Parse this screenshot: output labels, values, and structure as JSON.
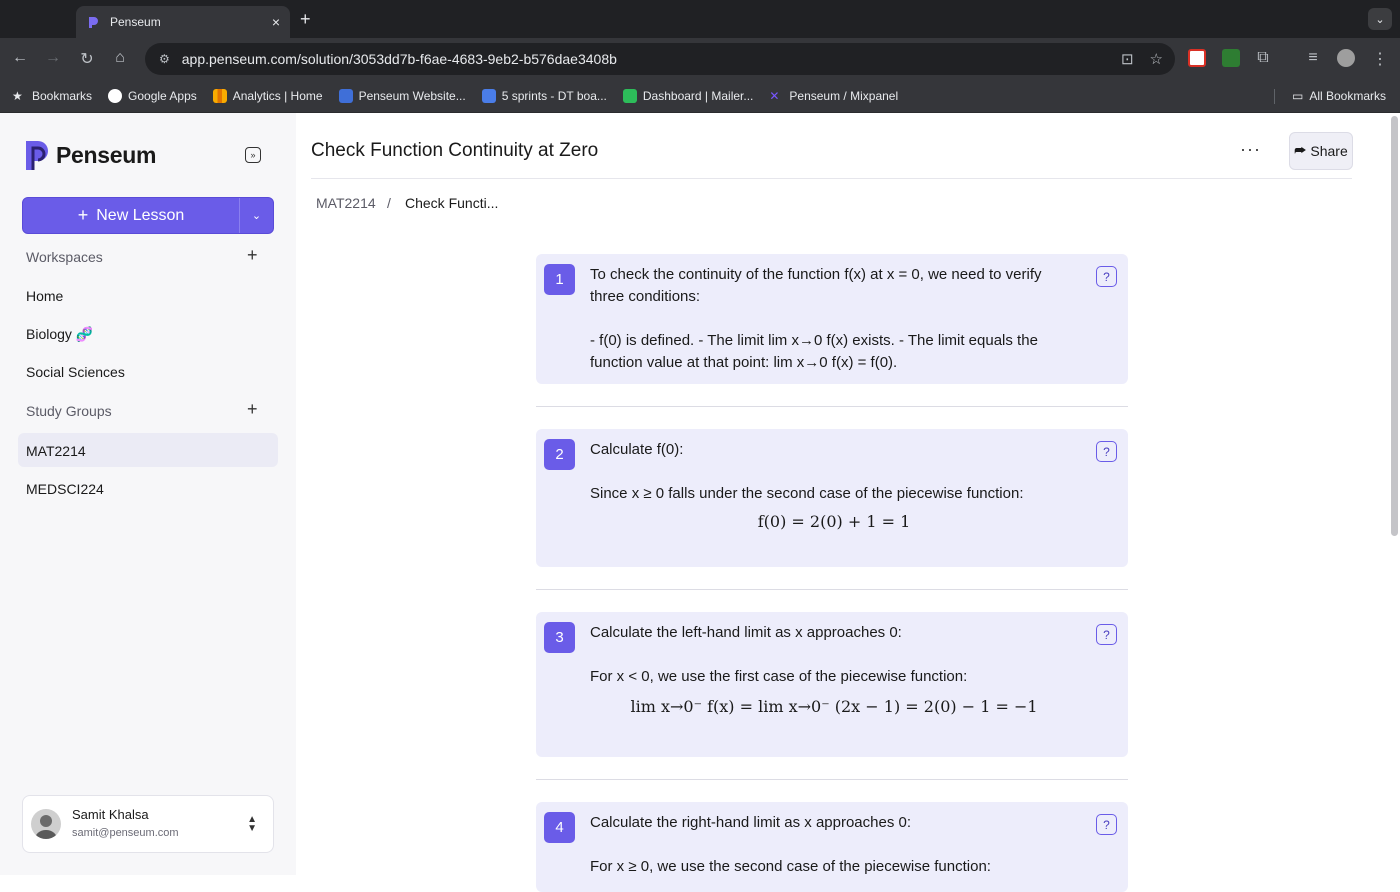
{
  "browser": {
    "tab_title": "Penseum",
    "tab_close": "×",
    "new_tab": "+",
    "url": "app.penseum.com/solution/3053dd7b-f6ae-4683-9eb2-b576dae3408b",
    "bookmarks": [
      {
        "label": "Bookmarks",
        "icon": "star-icon"
      },
      {
        "label": "Google Apps",
        "icon": "google-icon"
      },
      {
        "label": "Analytics | Home",
        "icon": "analytics-icon"
      },
      {
        "label": "Penseum Website...",
        "icon": "penseum-site-icon"
      },
      {
        "label": "5 sprints - DT boa...",
        "icon": "sprints-icon"
      },
      {
        "label": "Dashboard | Mailer...",
        "icon": "mailer-icon"
      },
      {
        "label": "Penseum / Mixpanel",
        "icon": "mixpanel-icon"
      }
    ],
    "all_bookmarks": "All Bookmarks"
  },
  "sidebar": {
    "logo_text": "Penseum",
    "new_lesson": "New Lesson",
    "workspaces_label": "Workspaces",
    "workspace_items": [
      "Home",
      "Biology 🧬",
      "Social Sciences"
    ],
    "study_groups_label": "Study Groups",
    "study_group_items": [
      "MAT2214",
      "MEDSCI224"
    ],
    "active_item": "MAT2214",
    "user": {
      "name": "Samit Khalsa",
      "email": "samit@penseum.com"
    }
  },
  "main": {
    "title": "Check Function Continuity at Zero",
    "more": "···",
    "share": "Share",
    "breadcrumb": [
      "MAT2214",
      "Check Functi..."
    ],
    "breadcrumb_sep": "/",
    "steps": [
      {
        "number": "1",
        "lines": [
          "To check the continuity of the function f(x) at x = 0, we need to verify three conditions:",
          "- f(0) is defined. - The limit lim x→0 f(x) exists. - The limit equals the function value at that point: lim x→0 f(x) = f(0)."
        ]
      },
      {
        "number": "2",
        "lines": [
          "Calculate f(0):",
          "Since x ≥ 0 falls under the second case of the piecewise function:"
        ],
        "display": "f(0) = 2(0) + 1 = 1"
      },
      {
        "number": "3",
        "lines": [
          "Calculate the left-hand limit as x approaches 0:",
          "For x < 0, we use the first case of the piecewise function:"
        ],
        "display": "lim x→0⁻ f(x) = lim x→0⁻ (2x − 1) = 2(0) − 1 = −1"
      },
      {
        "number": "4",
        "lines": [
          "Calculate the right-hand limit as x approaches 0:",
          "For x ≥ 0, we use the second case of the piecewise function:"
        ]
      }
    ],
    "help_glyph": "?"
  },
  "colors": {
    "accent": "#6a5ce8",
    "step_bg": "#ededfb",
    "sidebar_bg": "#f7f7f9"
  }
}
